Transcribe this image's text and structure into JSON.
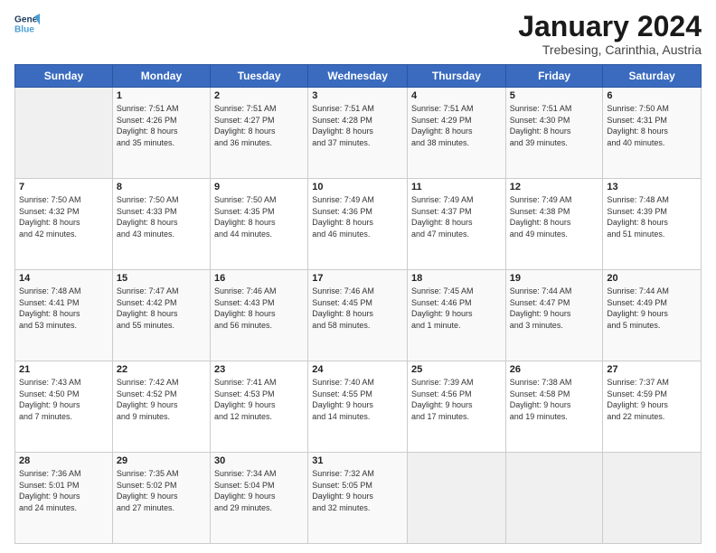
{
  "header": {
    "logo_line1": "General",
    "logo_line2": "Blue",
    "main_title": "January 2024",
    "subtitle": "Trebesing, Carinthia, Austria"
  },
  "days_of_week": [
    "Sunday",
    "Monday",
    "Tuesday",
    "Wednesday",
    "Thursday",
    "Friday",
    "Saturday"
  ],
  "weeks": [
    [
      {
        "day": "",
        "info": ""
      },
      {
        "day": "1",
        "info": "Sunrise: 7:51 AM\nSunset: 4:26 PM\nDaylight: 8 hours\nand 35 minutes."
      },
      {
        "day": "2",
        "info": "Sunrise: 7:51 AM\nSunset: 4:27 PM\nDaylight: 8 hours\nand 36 minutes."
      },
      {
        "day": "3",
        "info": "Sunrise: 7:51 AM\nSunset: 4:28 PM\nDaylight: 8 hours\nand 37 minutes."
      },
      {
        "day": "4",
        "info": "Sunrise: 7:51 AM\nSunset: 4:29 PM\nDaylight: 8 hours\nand 38 minutes."
      },
      {
        "day": "5",
        "info": "Sunrise: 7:51 AM\nSunset: 4:30 PM\nDaylight: 8 hours\nand 39 minutes."
      },
      {
        "day": "6",
        "info": "Sunrise: 7:50 AM\nSunset: 4:31 PM\nDaylight: 8 hours\nand 40 minutes."
      }
    ],
    [
      {
        "day": "7",
        "info": "Sunrise: 7:50 AM\nSunset: 4:32 PM\nDaylight: 8 hours\nand 42 minutes."
      },
      {
        "day": "8",
        "info": "Sunrise: 7:50 AM\nSunset: 4:33 PM\nDaylight: 8 hours\nand 43 minutes."
      },
      {
        "day": "9",
        "info": "Sunrise: 7:50 AM\nSunset: 4:35 PM\nDaylight: 8 hours\nand 44 minutes."
      },
      {
        "day": "10",
        "info": "Sunrise: 7:49 AM\nSunset: 4:36 PM\nDaylight: 8 hours\nand 46 minutes."
      },
      {
        "day": "11",
        "info": "Sunrise: 7:49 AM\nSunset: 4:37 PM\nDaylight: 8 hours\nand 47 minutes."
      },
      {
        "day": "12",
        "info": "Sunrise: 7:49 AM\nSunset: 4:38 PM\nDaylight: 8 hours\nand 49 minutes."
      },
      {
        "day": "13",
        "info": "Sunrise: 7:48 AM\nSunset: 4:39 PM\nDaylight: 8 hours\nand 51 minutes."
      }
    ],
    [
      {
        "day": "14",
        "info": "Sunrise: 7:48 AM\nSunset: 4:41 PM\nDaylight: 8 hours\nand 53 minutes."
      },
      {
        "day": "15",
        "info": "Sunrise: 7:47 AM\nSunset: 4:42 PM\nDaylight: 8 hours\nand 55 minutes."
      },
      {
        "day": "16",
        "info": "Sunrise: 7:46 AM\nSunset: 4:43 PM\nDaylight: 8 hours\nand 56 minutes."
      },
      {
        "day": "17",
        "info": "Sunrise: 7:46 AM\nSunset: 4:45 PM\nDaylight: 8 hours\nand 58 minutes."
      },
      {
        "day": "18",
        "info": "Sunrise: 7:45 AM\nSunset: 4:46 PM\nDaylight: 9 hours\nand 1 minute."
      },
      {
        "day": "19",
        "info": "Sunrise: 7:44 AM\nSunset: 4:47 PM\nDaylight: 9 hours\nand 3 minutes."
      },
      {
        "day": "20",
        "info": "Sunrise: 7:44 AM\nSunset: 4:49 PM\nDaylight: 9 hours\nand 5 minutes."
      }
    ],
    [
      {
        "day": "21",
        "info": "Sunrise: 7:43 AM\nSunset: 4:50 PM\nDaylight: 9 hours\nand 7 minutes."
      },
      {
        "day": "22",
        "info": "Sunrise: 7:42 AM\nSunset: 4:52 PM\nDaylight: 9 hours\nand 9 minutes."
      },
      {
        "day": "23",
        "info": "Sunrise: 7:41 AM\nSunset: 4:53 PM\nDaylight: 9 hours\nand 12 minutes."
      },
      {
        "day": "24",
        "info": "Sunrise: 7:40 AM\nSunset: 4:55 PM\nDaylight: 9 hours\nand 14 minutes."
      },
      {
        "day": "25",
        "info": "Sunrise: 7:39 AM\nSunset: 4:56 PM\nDaylight: 9 hours\nand 17 minutes."
      },
      {
        "day": "26",
        "info": "Sunrise: 7:38 AM\nSunset: 4:58 PM\nDaylight: 9 hours\nand 19 minutes."
      },
      {
        "day": "27",
        "info": "Sunrise: 7:37 AM\nSunset: 4:59 PM\nDaylight: 9 hours\nand 22 minutes."
      }
    ],
    [
      {
        "day": "28",
        "info": "Sunrise: 7:36 AM\nSunset: 5:01 PM\nDaylight: 9 hours\nand 24 minutes."
      },
      {
        "day": "29",
        "info": "Sunrise: 7:35 AM\nSunset: 5:02 PM\nDaylight: 9 hours\nand 27 minutes."
      },
      {
        "day": "30",
        "info": "Sunrise: 7:34 AM\nSunset: 5:04 PM\nDaylight: 9 hours\nand 29 minutes."
      },
      {
        "day": "31",
        "info": "Sunrise: 7:32 AM\nSunset: 5:05 PM\nDaylight: 9 hours\nand 32 minutes."
      },
      {
        "day": "",
        "info": ""
      },
      {
        "day": "",
        "info": ""
      },
      {
        "day": "",
        "info": ""
      }
    ]
  ]
}
